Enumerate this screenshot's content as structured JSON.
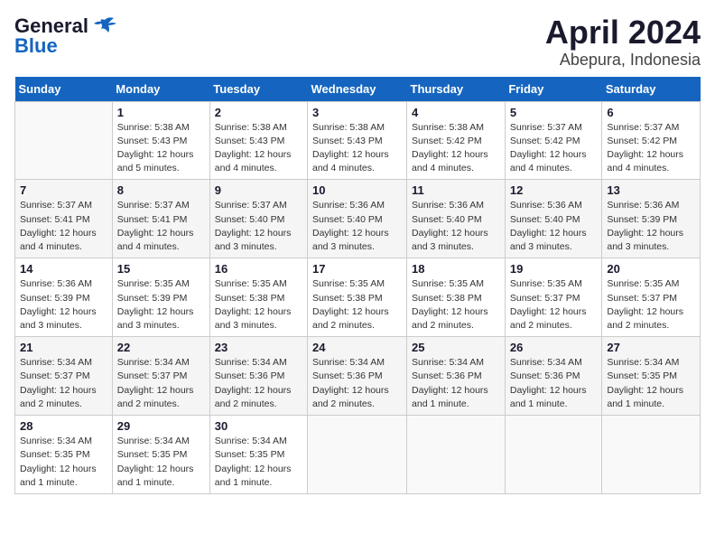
{
  "header": {
    "logo_general": "General",
    "logo_blue": "Blue",
    "month": "April 2024",
    "location": "Abepura, Indonesia"
  },
  "days_of_week": [
    "Sunday",
    "Monday",
    "Tuesday",
    "Wednesday",
    "Thursday",
    "Friday",
    "Saturday"
  ],
  "weeks": [
    [
      {
        "day": "",
        "details": ""
      },
      {
        "day": "1",
        "details": "Sunrise: 5:38 AM\nSunset: 5:43 PM\nDaylight: 12 hours\nand 5 minutes."
      },
      {
        "day": "2",
        "details": "Sunrise: 5:38 AM\nSunset: 5:43 PM\nDaylight: 12 hours\nand 4 minutes."
      },
      {
        "day": "3",
        "details": "Sunrise: 5:38 AM\nSunset: 5:43 PM\nDaylight: 12 hours\nand 4 minutes."
      },
      {
        "day": "4",
        "details": "Sunrise: 5:38 AM\nSunset: 5:42 PM\nDaylight: 12 hours\nand 4 minutes."
      },
      {
        "day": "5",
        "details": "Sunrise: 5:37 AM\nSunset: 5:42 PM\nDaylight: 12 hours\nand 4 minutes."
      },
      {
        "day": "6",
        "details": "Sunrise: 5:37 AM\nSunset: 5:42 PM\nDaylight: 12 hours\nand 4 minutes."
      }
    ],
    [
      {
        "day": "7",
        "details": "Sunrise: 5:37 AM\nSunset: 5:41 PM\nDaylight: 12 hours\nand 4 minutes."
      },
      {
        "day": "8",
        "details": "Sunrise: 5:37 AM\nSunset: 5:41 PM\nDaylight: 12 hours\nand 4 minutes."
      },
      {
        "day": "9",
        "details": "Sunrise: 5:37 AM\nSunset: 5:40 PM\nDaylight: 12 hours\nand 3 minutes."
      },
      {
        "day": "10",
        "details": "Sunrise: 5:36 AM\nSunset: 5:40 PM\nDaylight: 12 hours\nand 3 minutes."
      },
      {
        "day": "11",
        "details": "Sunrise: 5:36 AM\nSunset: 5:40 PM\nDaylight: 12 hours\nand 3 minutes."
      },
      {
        "day": "12",
        "details": "Sunrise: 5:36 AM\nSunset: 5:40 PM\nDaylight: 12 hours\nand 3 minutes."
      },
      {
        "day": "13",
        "details": "Sunrise: 5:36 AM\nSunset: 5:39 PM\nDaylight: 12 hours\nand 3 minutes."
      }
    ],
    [
      {
        "day": "14",
        "details": "Sunrise: 5:36 AM\nSunset: 5:39 PM\nDaylight: 12 hours\nand 3 minutes."
      },
      {
        "day": "15",
        "details": "Sunrise: 5:35 AM\nSunset: 5:39 PM\nDaylight: 12 hours\nand 3 minutes."
      },
      {
        "day": "16",
        "details": "Sunrise: 5:35 AM\nSunset: 5:38 PM\nDaylight: 12 hours\nand 3 minutes."
      },
      {
        "day": "17",
        "details": "Sunrise: 5:35 AM\nSunset: 5:38 PM\nDaylight: 12 hours\nand 2 minutes."
      },
      {
        "day": "18",
        "details": "Sunrise: 5:35 AM\nSunset: 5:38 PM\nDaylight: 12 hours\nand 2 minutes."
      },
      {
        "day": "19",
        "details": "Sunrise: 5:35 AM\nSunset: 5:37 PM\nDaylight: 12 hours\nand 2 minutes."
      },
      {
        "day": "20",
        "details": "Sunrise: 5:35 AM\nSunset: 5:37 PM\nDaylight: 12 hours\nand 2 minutes."
      }
    ],
    [
      {
        "day": "21",
        "details": "Sunrise: 5:34 AM\nSunset: 5:37 PM\nDaylight: 12 hours\nand 2 minutes."
      },
      {
        "day": "22",
        "details": "Sunrise: 5:34 AM\nSunset: 5:37 PM\nDaylight: 12 hours\nand 2 minutes."
      },
      {
        "day": "23",
        "details": "Sunrise: 5:34 AM\nSunset: 5:36 PM\nDaylight: 12 hours\nand 2 minutes."
      },
      {
        "day": "24",
        "details": "Sunrise: 5:34 AM\nSunset: 5:36 PM\nDaylight: 12 hours\nand 2 minutes."
      },
      {
        "day": "25",
        "details": "Sunrise: 5:34 AM\nSunset: 5:36 PM\nDaylight: 12 hours\nand 1 minute."
      },
      {
        "day": "26",
        "details": "Sunrise: 5:34 AM\nSunset: 5:36 PM\nDaylight: 12 hours\nand 1 minute."
      },
      {
        "day": "27",
        "details": "Sunrise: 5:34 AM\nSunset: 5:35 PM\nDaylight: 12 hours\nand 1 minute."
      }
    ],
    [
      {
        "day": "28",
        "details": "Sunrise: 5:34 AM\nSunset: 5:35 PM\nDaylight: 12 hours\nand 1 minute."
      },
      {
        "day": "29",
        "details": "Sunrise: 5:34 AM\nSunset: 5:35 PM\nDaylight: 12 hours\nand 1 minute."
      },
      {
        "day": "30",
        "details": "Sunrise: 5:34 AM\nSunset: 5:35 PM\nDaylight: 12 hours\nand 1 minute."
      },
      {
        "day": "",
        "details": ""
      },
      {
        "day": "",
        "details": ""
      },
      {
        "day": "",
        "details": ""
      },
      {
        "day": "",
        "details": ""
      }
    ]
  ]
}
